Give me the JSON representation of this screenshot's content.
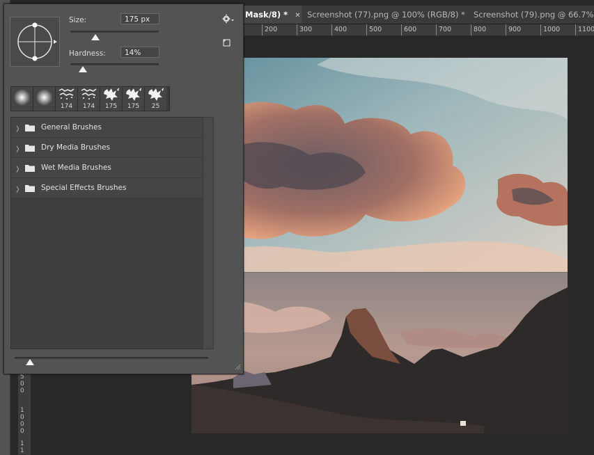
{
  "document_tabs": [
    {
      "label": "Mask/8) *",
      "close": "✕",
      "active": true
    },
    {
      "label": "Screenshot (77).png @ 100% (RGB/8) *",
      "close": "✕",
      "active": false
    },
    {
      "label": "Screenshot (79).png @ 66.7% (RGB",
      "close": "",
      "active": false
    }
  ],
  "ruler": {
    "top_ticks": [
      "200",
      "300",
      "400",
      "500",
      "600",
      "700",
      "800",
      "900",
      "1000",
      "1100"
    ],
    "left_digits": [
      "5",
      "0",
      "0",
      "1",
      "0",
      "0",
      "0",
      "1",
      "1"
    ]
  },
  "brush_panel": {
    "size_label": "Size:",
    "size_value": "175 px",
    "size_level": 0.28,
    "hardness_label": "Hardness:",
    "hardness_value": "14%",
    "hardness_level": 0.14,
    "spacing_level": 0.08,
    "settings_icon": "gear-icon",
    "new_preset_icon": "new-preset-icon",
    "recent_presets": [
      {
        "kind": "soft-round",
        "size": ""
      },
      {
        "kind": "soft-round",
        "size": ""
      },
      {
        "kind": "scatter-brush",
        "size": "174"
      },
      {
        "kind": "scatter-brush",
        "size": "174"
      },
      {
        "kind": "splatter-brush",
        "size": "175"
      },
      {
        "kind": "splatter-brush",
        "size": "175"
      },
      {
        "kind": "splatter-brush",
        "size": "25"
      }
    ],
    "folders": [
      {
        "name": "General Brushes"
      },
      {
        "name": "Dry Media Brushes"
      },
      {
        "name": "Wet Media Brushes"
      },
      {
        "name": "Special Effects Brushes"
      }
    ]
  },
  "colors": {
    "panel_bg": "#535353",
    "app_bg": "#282828",
    "sky_top": "#6c9aa8",
    "cloud_warm": "#e59a78",
    "mountain_dark": "#2f2a2a"
  }
}
